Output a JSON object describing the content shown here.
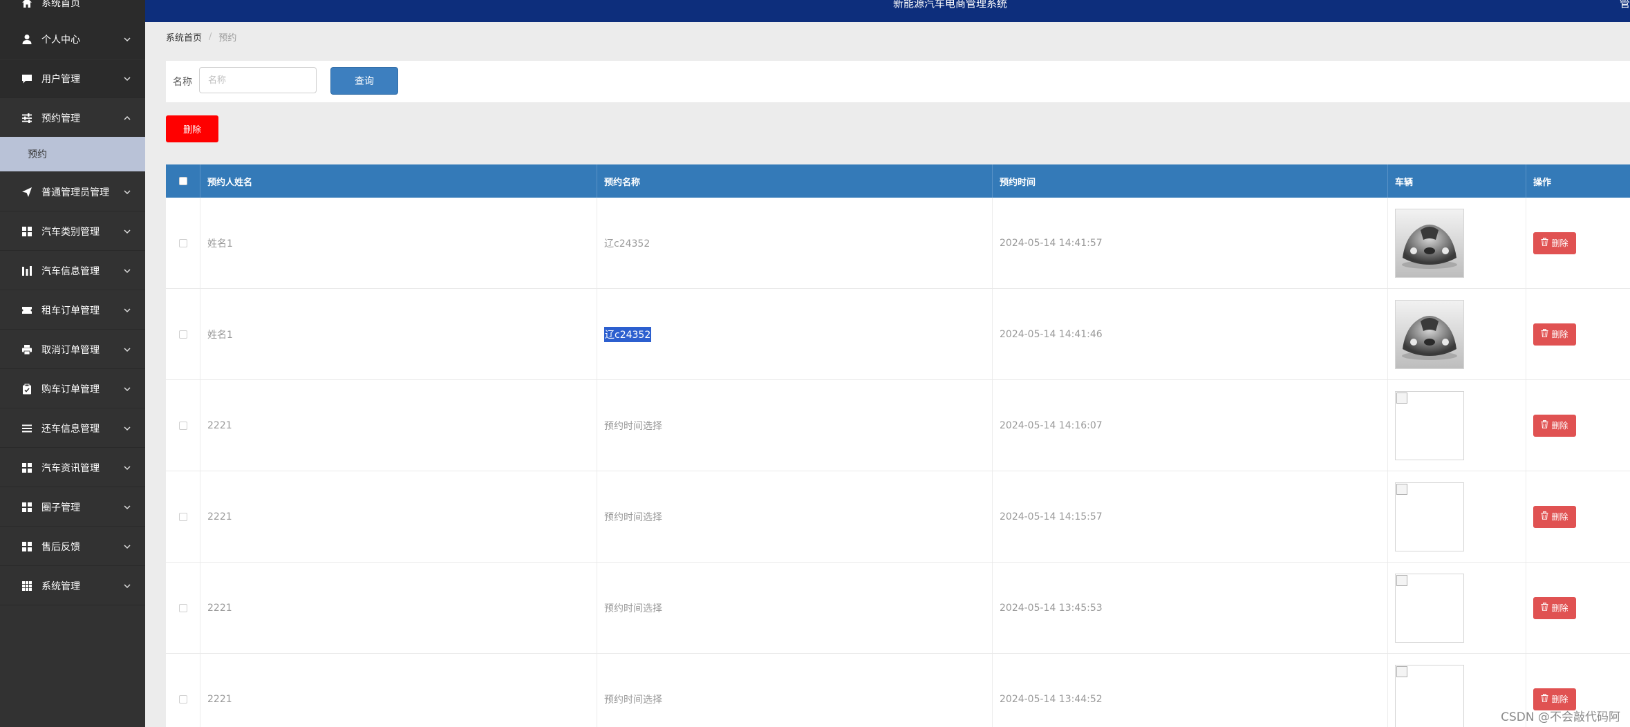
{
  "header": {
    "title": "新能源汽车电商管理系统",
    "right_text": "管"
  },
  "sidebar": {
    "items": [
      {
        "label": "系统首页",
        "icon": "home-icon",
        "chevron": ""
      },
      {
        "label": "个人中心",
        "icon": "user-icon",
        "chevron": "down"
      },
      {
        "label": "用户管理",
        "icon": "chat-icon",
        "chevron": "down"
      },
      {
        "label": "预约管理",
        "icon": "sliders-icon",
        "chevron": "up"
      },
      {
        "label": "普通管理员管理",
        "icon": "send-icon",
        "chevron": "down"
      },
      {
        "label": "汽车类别管理",
        "icon": "grid-icon",
        "chevron": "down"
      },
      {
        "label": "汽车信息管理",
        "icon": "bar-chart-icon",
        "chevron": "down"
      },
      {
        "label": "租车订单管理",
        "icon": "ticket-icon",
        "chevron": "down"
      },
      {
        "label": "取消订单管理",
        "icon": "print-icon",
        "chevron": "down"
      },
      {
        "label": "购车订单管理",
        "icon": "clipboard-icon",
        "chevron": "down"
      },
      {
        "label": "还车信息管理",
        "icon": "list-icon",
        "chevron": "down"
      },
      {
        "label": "汽车资讯管理",
        "icon": "grid-icon",
        "chevron": "down"
      },
      {
        "label": "圈子管理",
        "icon": "grid-icon",
        "chevron": "down"
      },
      {
        "label": "售后反馈",
        "icon": "grid-icon",
        "chevron": "down"
      },
      {
        "label": "系统管理",
        "icon": "table-icon",
        "chevron": "down"
      }
    ],
    "sub_item": "预约"
  },
  "breadcrumb": {
    "home": "系统首页",
    "separator": "/",
    "current": "预约"
  },
  "search": {
    "label": "名称",
    "placeholder": "名称",
    "value": "",
    "button": "查询"
  },
  "toolbar": {
    "delete_label": "删除"
  },
  "table": {
    "columns": [
      "预约人姓名",
      "预约名称",
      "预约时间",
      "车辆",
      "操作"
    ],
    "rows": [
      {
        "name": "姓名1",
        "title": "辽c24352",
        "time": "2024-05-14 14:41:57",
        "image": "car-photo",
        "action": "删除",
        "title_selected": false
      },
      {
        "name": "姓名1",
        "title": "辽c24352",
        "time": "2024-05-14 14:41:46",
        "image": "car-photo",
        "action": "删除",
        "title_selected": true
      },
      {
        "name": "2221",
        "title": "预约时间选择",
        "time": "2024-05-14 14:16:07",
        "image": "broken-image",
        "action": "删除",
        "title_selected": false
      },
      {
        "name": "2221",
        "title": "预约时间选择",
        "time": "2024-05-14 14:15:57",
        "image": "broken-image",
        "action": "删除",
        "title_selected": false
      },
      {
        "name": "2221",
        "title": "预约时间选择",
        "time": "2024-05-14 13:45:53",
        "image": "broken-image",
        "action": "删除",
        "title_selected": false
      },
      {
        "name": "2221",
        "title": "预约时间选择",
        "time": "2024-05-14 13:44:52",
        "image": "broken-image",
        "action": "删除",
        "title_selected": false
      }
    ]
  },
  "watermark": "CSDN @不会敲代码阿",
  "colors": {
    "header_bg": "#0d2e7c",
    "sidebar_bg": "#323232",
    "sub_item_bg": "#b9c2d7",
    "table_header_bg": "#347ab8",
    "query_button": "#3d7fbf",
    "delete_button": "#ff0000",
    "row_delete_button": "#e05252"
  }
}
